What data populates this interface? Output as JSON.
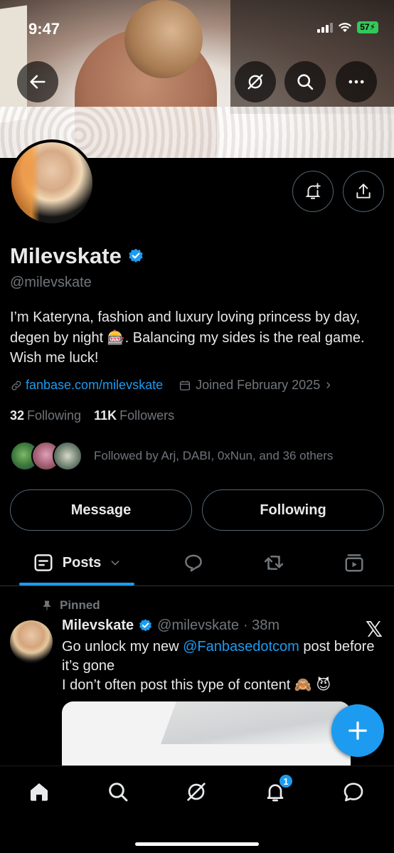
{
  "status_bar": {
    "time": "9:47",
    "battery": "57"
  },
  "profile": {
    "display_name": "Milevskate",
    "handle": "@milevskate",
    "bio": "I’m Kateryna, fashion and luxury loving princess by day, degen by night 🎰. Balancing my sides is the real game. Wish me luck!",
    "website": "fanbase.com/milevskate",
    "joined": "Joined February 2025",
    "following_count": "32",
    "following_label": "Following",
    "followers_count": "11K",
    "followers_label": "Followers",
    "followed_by": "Followed by Arj, DABI, 0xNun, and 36 others"
  },
  "actions": {
    "message_label": "Message",
    "following_label": "Following"
  },
  "tabs": [
    {
      "label": "Posts",
      "icon": "posts-icon"
    },
    {
      "icon": "replies-icon"
    },
    {
      "icon": "retweet-icon"
    },
    {
      "icon": "media-icon"
    }
  ],
  "pinned_post": {
    "pinned_label": "Pinned",
    "author": "Milevskate",
    "handle": "@milevskate",
    "time": "· 38m",
    "text_prefix": "Go unlock my new ",
    "mention": "@Fanbasedotcom",
    "text_suffix": " post before it’s gone",
    "line2": "I don’t often post this type of content 🙈 😈"
  },
  "bottom_nav": {
    "notifications_badge": "1"
  },
  "colors": {
    "accent": "#1d9bf0",
    "background": "#000000",
    "muted": "#71767b"
  }
}
